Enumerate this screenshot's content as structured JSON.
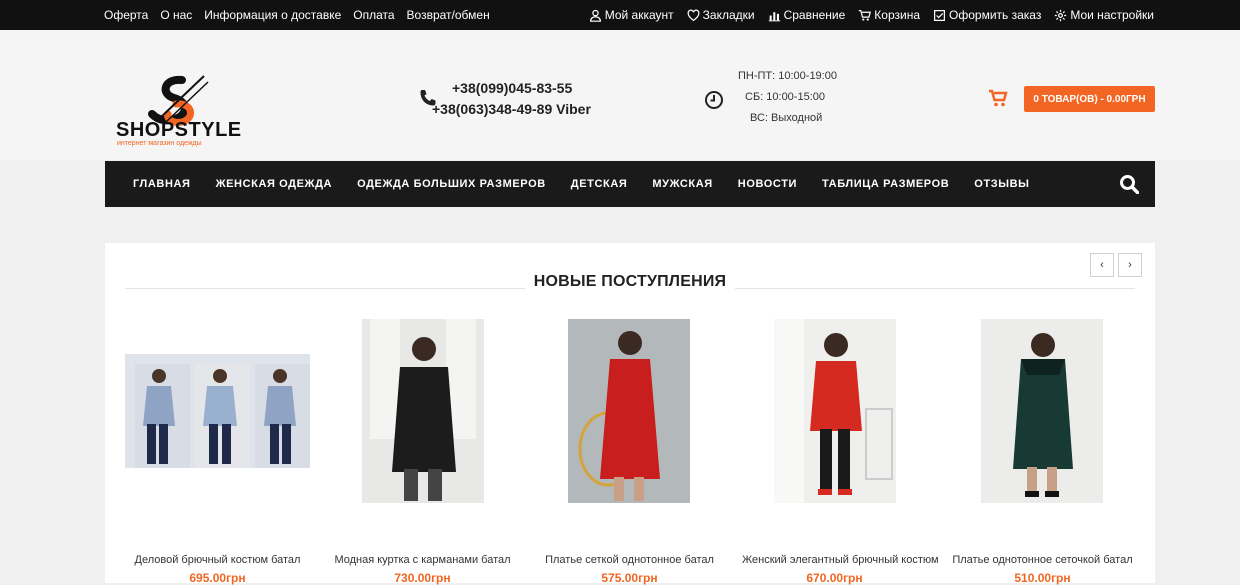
{
  "topbar": {
    "left_links": [
      "Оферта",
      "О нас",
      "Информация о доставке",
      "Оплата",
      "Возврат/обмен"
    ],
    "right_links": [
      {
        "label": "Мой аккаунт",
        "icon": "user-icon"
      },
      {
        "label": "Закладки",
        "icon": "heart-icon"
      },
      {
        "label": "Сравнение",
        "icon": "bar-chart-icon"
      },
      {
        "label": "Корзина",
        "icon": "cart-icon"
      },
      {
        "label": "Оформить заказ",
        "icon": "checkbox-icon"
      },
      {
        "label": "Мои настройки",
        "icon": "gear-icon"
      }
    ]
  },
  "header": {
    "logo_text": "SHOPSTYLE",
    "logo_subtitle": "интернет магазин одежды",
    "phone1": "+38(099)045-83-55",
    "phone2": "+38(063)348-49-89 Viber",
    "hours": [
      "ПН-ПТ: 10:00-19:00",
      "СБ: 10:00-15:00",
      "ВС: Выходной"
    ],
    "cart_button": "0 ТОВАР(ОВ) - 0.00ГРН"
  },
  "nav": {
    "items": [
      "ГЛАВНАЯ",
      "ЖЕНСКАЯ ОДЕЖДА",
      "ОДЕЖДА БОЛЬШИХ РАЗМЕРОВ",
      "ДЕТСКАЯ",
      "МУЖСКАЯ",
      "НОВОСТИ",
      "ТАБЛИЦА РАЗМЕРОВ",
      "ОТЗЫВЫ"
    ]
  },
  "section": {
    "title": "НОВЫЕ ПОСТУПЛЕНИЯ",
    "prev": "‹",
    "next": "›"
  },
  "products": [
    {
      "name": "Деловой брючный костюм батал",
      "price": "695.00грн"
    },
    {
      "name": "Модная куртка с карманами батал",
      "price": "730.00грн"
    },
    {
      "name": "Платье сеткой однотонное батал",
      "price": "575.00грн"
    },
    {
      "name": "Женский элегантный брючный костюм",
      "price": "670.00грн"
    },
    {
      "name": "Платье однотонное сеточкой батал",
      "price": "510.00грн"
    }
  ],
  "colors": {
    "accent": "#f26522",
    "dark": "#111111"
  }
}
